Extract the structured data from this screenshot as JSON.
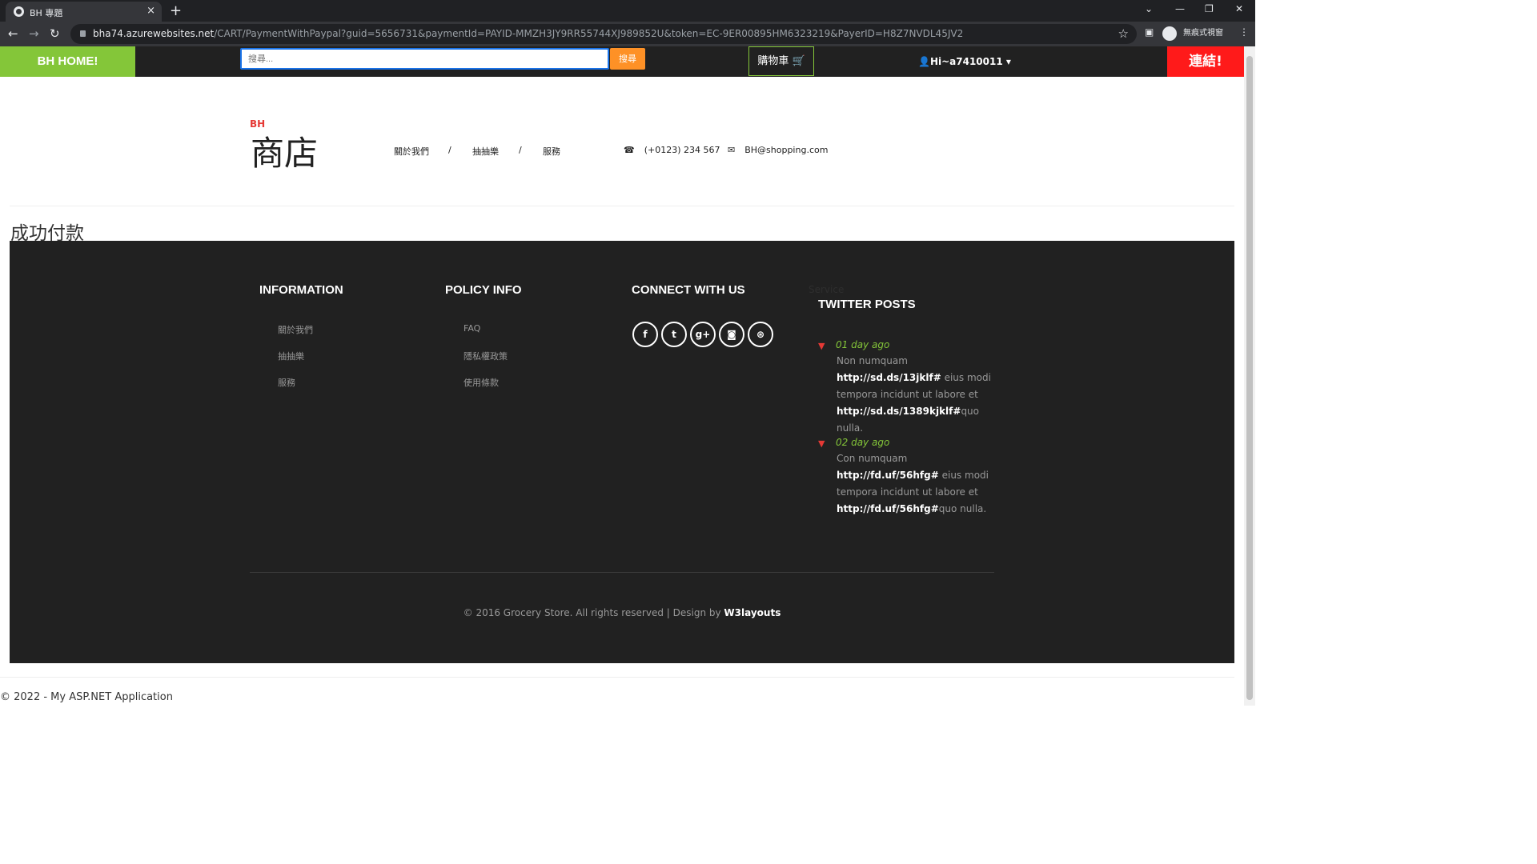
{
  "browser": {
    "tab_title": "BH 專題",
    "tab_close": "×",
    "new_tab": "+",
    "url_host": "bha74.azurewebsites.net",
    "url_path": "/CART/PaymentWithPaypal?guid=5656731&paymentId=PAYID-MMZH3JY9RR55744XJ989852U&token=EC-9ER00895HM6323219&PayerID=H8Z7NVDL45JV2",
    "profile_label": "無痕式視窗",
    "back": "←",
    "forward": "→",
    "reload": "↻",
    "bookmark_star": "☆",
    "minimize": "—",
    "restore": "❐",
    "close_window": "✕",
    "tab_search": "⌄",
    "side_panel": "▣",
    "menu": "⋮"
  },
  "topnav": {
    "home_label": "BH HOME!",
    "search_placeholder": "搜尋...",
    "search_button": "搜尋",
    "cart_label": "購物車 🛒",
    "user_label": "Hi~a7410011 ▾",
    "connect_label": "連結!"
  },
  "header": {
    "logo_small": "BH",
    "logo_main": "商店",
    "menu": [
      "關於我們",
      "抽抽樂",
      "服務"
    ],
    "separator": "/",
    "phone": "(+0123) 234 567",
    "email": "BH@shopping.com"
  },
  "main": {
    "title": "成功付款"
  },
  "footer": {
    "information": {
      "title": "INFORMATION",
      "links": [
        "關於我們",
        "抽抽樂",
        "服務"
      ]
    },
    "policy": {
      "title": "POLICY INFO",
      "links": [
        "FAQ",
        "隱私權政策",
        "使用條款"
      ]
    },
    "connect": {
      "title": "CONNECT WITH US",
      "icons": [
        "f",
        "t",
        "g+",
        "◙",
        "⊛"
      ]
    },
    "service_ghost": "Service",
    "twitter": {
      "title": "TWITTER POSTS",
      "posts": [
        {
          "date": "01 day ago",
          "text_html_parts": [
            "Non numquam ",
            "http://sd.ds/13jklf#",
            " eius modi tempora incidunt ut labore et ",
            "http://sd.ds/1389kjklf#",
            "quo nulla."
          ]
        },
        {
          "date": "02 day ago",
          "text_html_parts": [
            "Con numquam ",
            "http://fd.uf/56hfg#",
            " eius modi tempora incidunt ut labore et ",
            "http://fd.uf/56hfg#",
            "quo nulla."
          ]
        }
      ]
    },
    "copyright_prefix": "© 2016 Grocery Store. All rights reserved | Design by ",
    "copyright_link": "W3layouts"
  },
  "page_footer": "© 2022 - My ASP.NET Application",
  "colors": {
    "green": "#84c639",
    "orange": "#fe9126",
    "red": "#ff1a1a",
    "dark": "#212121"
  }
}
